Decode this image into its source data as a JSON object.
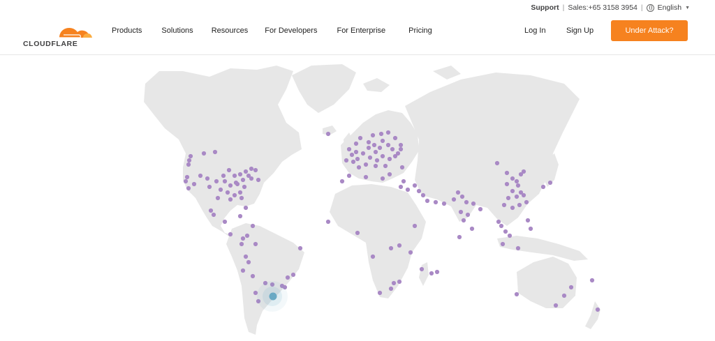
{
  "topbar": {
    "support": "Support",
    "sales": "Sales:+65 3158 3954",
    "language": "English"
  },
  "brand": {
    "name": "CLOUDFLARE",
    "color": "#f6821f"
  },
  "nav": {
    "items": [
      "Products",
      "Solutions",
      "Resources",
      "For Developers",
      "For Enterprise",
      "Pricing"
    ]
  },
  "header": {
    "login": "Log In",
    "signup": "Sign Up",
    "attack_button": "Under Attack?"
  },
  "map": {
    "land_color": "#e7e7e7",
    "datacenter_color": "#a989c5",
    "highlight_color": "#6aa9c4"
  }
}
